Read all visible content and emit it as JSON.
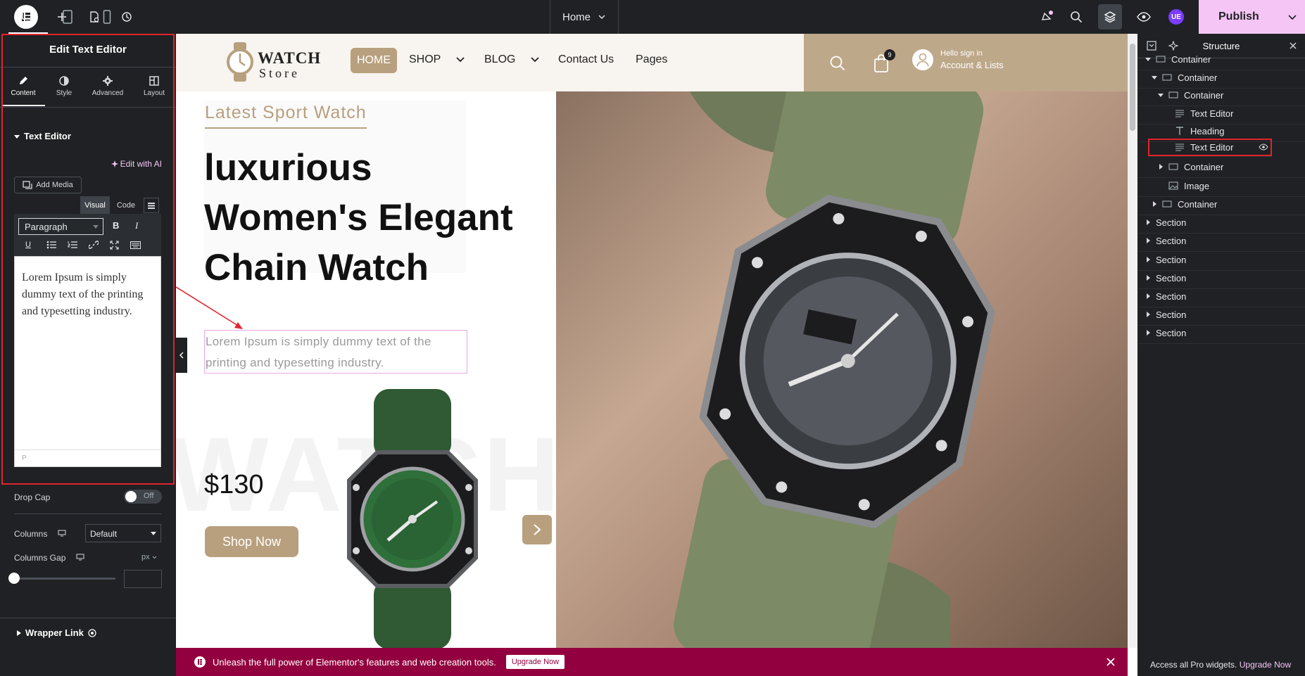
{
  "topbar": {
    "page_selector": "Home",
    "publish_label": "Publish",
    "user_initials": "UE"
  },
  "left_panel": {
    "title": "Edit Text Editor",
    "tabs": [
      {
        "label": "Content",
        "icon": "pencil-icon"
      },
      {
        "label": "Style",
        "icon": "half-circle-icon"
      },
      {
        "label": "Advanced",
        "icon": "gear-icon"
      },
      {
        "label": "Layout",
        "icon": "layout-icon"
      }
    ],
    "section_title": "Text Editor",
    "edit_ai": "Edit with AI",
    "add_media": "Add Media",
    "visual_label": "Visual",
    "code_label": "Code",
    "format_select": "Paragraph",
    "editor_text": "Lorem Ipsum is simply dummy text of the printing and typesetting industry.",
    "editor_path": "P",
    "drop_cap_label": "Drop Cap",
    "drop_cap_state": "Off",
    "columns_label": "Columns",
    "columns_value": "Default",
    "columns_gap_label": "Columns Gap",
    "columns_gap_unit": "px",
    "columns_gap_value": "",
    "wrapper_link_label": "Wrapper Link"
  },
  "site": {
    "logo_line1": "WATCH",
    "logo_line2": "Store",
    "nav": [
      "HOME",
      "SHOP",
      "BLOG",
      "Contact Us",
      "Pages"
    ],
    "cart_count": "9",
    "account_greeting": "Hello sign in",
    "account_label": "Account & Lists",
    "hero_subtitle": "Latest Sport Watch",
    "hero_title_lines": [
      "luxurious",
      "Women's Elegant",
      "Chain Watch"
    ],
    "hero_text": "Lorem Ipsum is simply dummy text of the printing and typesetting industry.",
    "price": "$130",
    "cta": "Shop Now",
    "watermark": "WATCH"
  },
  "structure": {
    "title": "Structure",
    "nodes": [
      {
        "label": "Container"
      },
      {
        "label": "Container"
      },
      {
        "label": "Container"
      },
      {
        "label": "Text Editor"
      },
      {
        "label": "Heading"
      },
      {
        "label": "Text Editor"
      },
      {
        "label": "Container"
      },
      {
        "label": "Image"
      },
      {
        "label": "Container"
      },
      {
        "label": "Section"
      },
      {
        "label": "Section"
      },
      {
        "label": "Section"
      },
      {
        "label": "Section"
      },
      {
        "label": "Section"
      },
      {
        "label": "Section"
      },
      {
        "label": "Section"
      }
    ],
    "footer_text": "Access all Pro widgets.",
    "footer_link": "Upgrade Now"
  },
  "promo": {
    "text": "Unleash the full power of Elementor's features and web creation tools.",
    "button": "Upgrade Now"
  },
  "colors": {
    "accent_brown": "#b8a07e",
    "publish_pink": "#f5c6f5",
    "promo_crimson": "#93003f",
    "dark_panel": "#1f2124",
    "selection_red": "#e0242c"
  }
}
